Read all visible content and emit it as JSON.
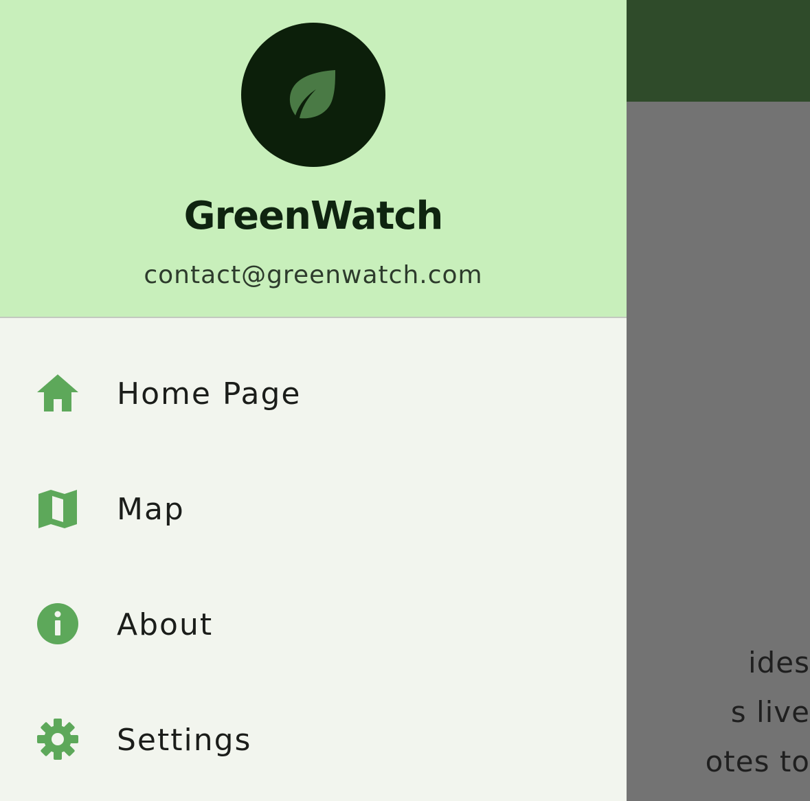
{
  "background": {
    "text_lines": [
      "ides",
      "s live",
      "otes to"
    ]
  },
  "drawer": {
    "header": {
      "app_name": "GreenWatch",
      "email": "contact@greenwatch.com",
      "avatar_icon": "leaf-icon"
    },
    "items": [
      {
        "label": "Home Page",
        "icon": "home-icon"
      },
      {
        "label": "Map",
        "icon": "map-icon"
      },
      {
        "label": "About",
        "icon": "info-icon"
      },
      {
        "label": "Settings",
        "icon": "gear-icon"
      }
    ]
  },
  "colors": {
    "header_bg": "#c8efbb",
    "drawer_bg": "#f2f5ee",
    "accent_icon": "#5da85a",
    "avatar_bg": "#0c1f0a",
    "app_bar": "#2f4b2a",
    "scrim": "#737373"
  }
}
